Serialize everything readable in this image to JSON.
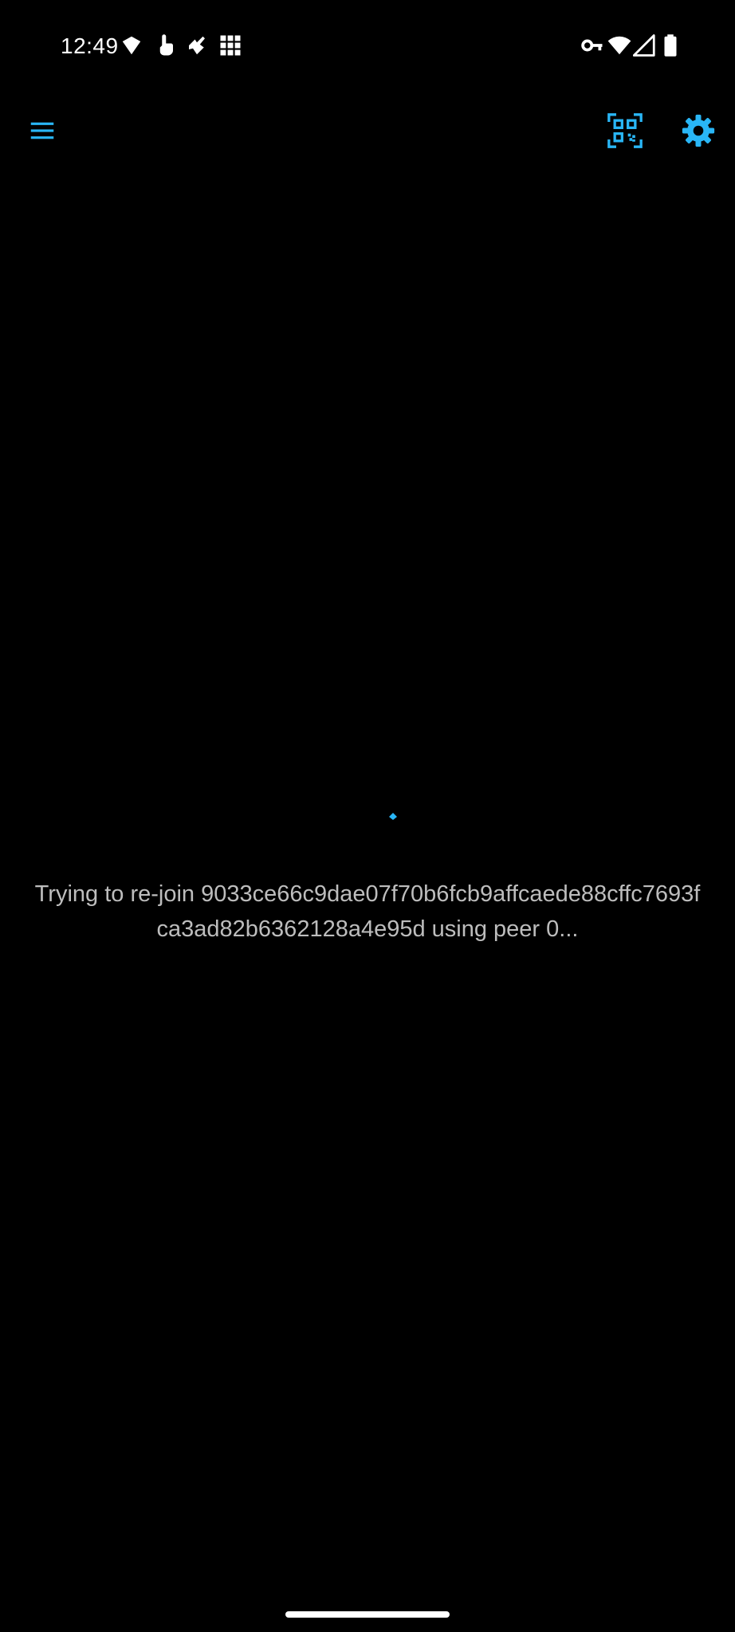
{
  "status_bar": {
    "time": "12:49",
    "left_icons": [
      "notification-shield-icon",
      "touch-icon",
      "puzzle-icon",
      "apps-grid-icon"
    ],
    "right_icons": [
      "vpn-key-icon",
      "wifi-icon",
      "cellular-signal-icon",
      "battery-icon"
    ]
  },
  "app_bar": {
    "menu_icon": "menu-icon",
    "actions": [
      "qr-code-icon",
      "settings-gear-icon"
    ]
  },
  "loading": {
    "message_line1": "Trying to re-join 9033ce66c9dae07f70b6fcb9affcaede88cffc7693f",
    "message_line2": "ca3ad82b6362128a4e95d using peer 0..."
  },
  "colors": {
    "accent": "#29b6f6",
    "background": "#000000",
    "text_secondary": "#bdbdbd"
  }
}
